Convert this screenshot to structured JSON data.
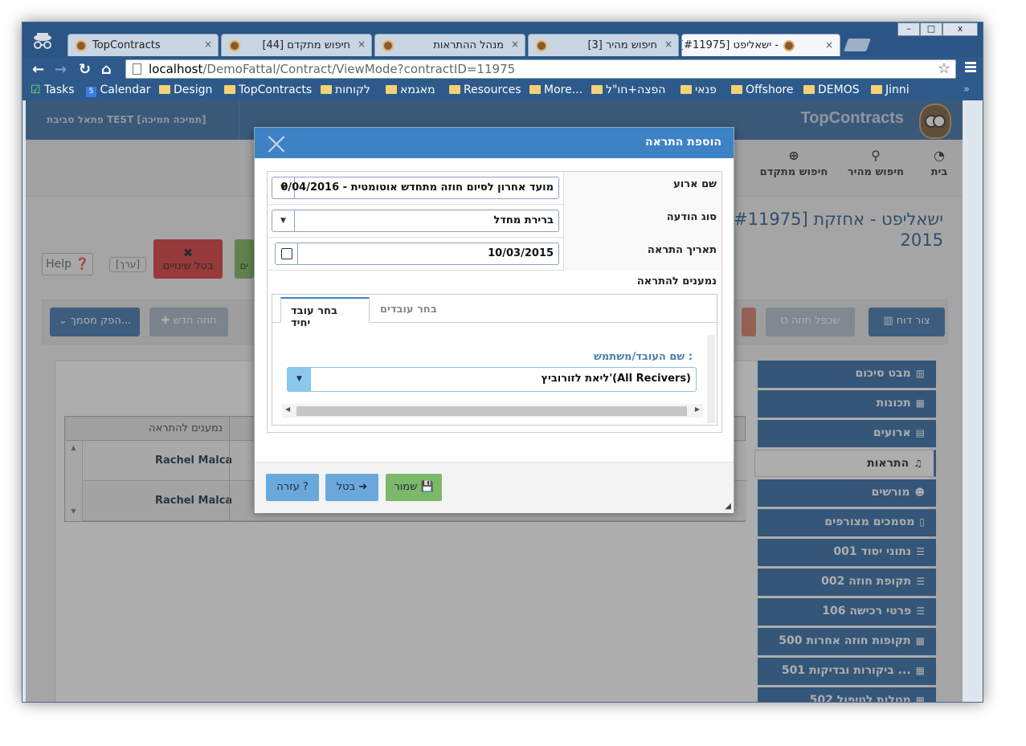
{
  "browser": {
    "tabs": [
      {
        "label": "TopContracts",
        "active": false
      },
      {
        "label": "[44] חיפוש מתקדם",
        "active": false
      },
      {
        "label": "מנהל ההתראות",
        "active": false
      },
      {
        "label": "[3] חיפוש מהיר",
        "active": false
      },
      {
        "label": "[#11975] ישאליפט -",
        "active": true
      }
    ],
    "window_buttons": {
      "minimize": "–",
      "maximize": "□",
      "close": "x"
    },
    "url_host": "localhost",
    "url_path": "/DemoFattal/Contract/ViewMode?contractID=11975",
    "bookmarks": [
      {
        "label": "Tasks",
        "icon": "checkbox-icon"
      },
      {
        "label": "Calendar",
        "icon": "calendar-icon"
      },
      {
        "label": "Design",
        "icon": "folder-icon"
      },
      {
        "label": "TopContracts",
        "icon": "folder-icon"
      },
      {
        "label": "לקוחות",
        "icon": "folder-icon"
      },
      {
        "label": "מאגמא",
        "icon": "folder-icon"
      },
      {
        "label": "Resources",
        "icon": "folder-icon"
      },
      {
        "label": "More...",
        "icon": "folder-icon"
      },
      {
        "label": "הפצה+חו\"ל",
        "icon": "folder-icon"
      },
      {
        "label": "פנאי",
        "icon": "folder-icon"
      },
      {
        "label": "Offshore",
        "icon": "folder-icon"
      },
      {
        "label": "DEMOS",
        "icon": "folder-icon"
      },
      {
        "label": "Jinni",
        "icon": "folder-icon"
      }
    ],
    "bookmarks_overflow": "»"
  },
  "app": {
    "brand": "TopContracts",
    "env_label": "פתאל סביבת TEST [תמיכה תמיכה]",
    "topnav": [
      {
        "label": "בית",
        "icon": "dashboard-icon"
      },
      {
        "label": "חיפוש מהיר",
        "icon": "search-icon"
      },
      {
        "label": "חיפוש מתקדם",
        "icon": "zoom-in-icon"
      }
    ],
    "page_title_line1": "[#11975] ישאליפט - אחזקת",
    "page_title_line2": "2015",
    "help_label": "Help",
    "edit_label": "[ערך]",
    "cancel_changes_label": "בטל שינויים",
    "green_stub_label": "ים",
    "report_label": "צור דוח",
    "copy_label": "שכפל חוזה",
    "new_contract_label": "חוזה חדש",
    "doc_label": "הפק מסמך...",
    "grid": {
      "header": "נמענים להתראה",
      "rows": [
        "Rachel Malca",
        "Rachel Malca"
      ]
    },
    "sidebar": [
      {
        "label": "מבט סיכום",
        "icon": "barcode-icon",
        "active": false
      },
      {
        "label": "תכונות",
        "icon": "grid-icon",
        "active": false
      },
      {
        "label": "ארועים",
        "icon": "calendar-icon",
        "active": false
      },
      {
        "label": "התראות",
        "icon": "bell-icon",
        "active": true
      },
      {
        "label": "מורשים",
        "icon": "users-icon",
        "active": false
      },
      {
        "label": "מסמכים מצורפים",
        "icon": "file-icon",
        "active": false
      },
      {
        "label": "001 נתוני יסוד",
        "icon": "list-icon",
        "active": false
      },
      {
        "label": "002 תקופת חוזה",
        "icon": "list-icon",
        "active": false
      },
      {
        "label": "106 פרטי רכישה",
        "icon": "list-icon",
        "active": false
      },
      {
        "label": "500 תקופות חוזה אחרות",
        "icon": "table-icon",
        "active": false
      },
      {
        "label": "501 ביקורות ובדיקות ...",
        "icon": "table-icon",
        "active": false
      },
      {
        "label": "502 מטלות לטיפול",
        "icon": "table-icon",
        "active": false
      }
    ]
  },
  "modal": {
    "title": "הוספת התראה",
    "event_name_label": "שם ארוע",
    "event_name_value": "מועד אחרון לסיום חוזה מתחדש אוטומטית - 0/04/2016",
    "notice_type_label": "סוג הודעה",
    "notice_type_value": "ברירת מחדל",
    "alert_date_label": "תאריך התראה",
    "alert_date_value": "10/03/2015",
    "recipients_label": "נמענים להתראה",
    "tab_single": "בחר עובד יחיד",
    "tab_multi": "בחר עובדים",
    "user_label": "שם העובד/משתמש :",
    "user_value": "ליאת לזורוביץ'(All Recivers)",
    "save_label": "שמור",
    "cancel_label": "בטל",
    "help_label": "עזרה"
  }
}
